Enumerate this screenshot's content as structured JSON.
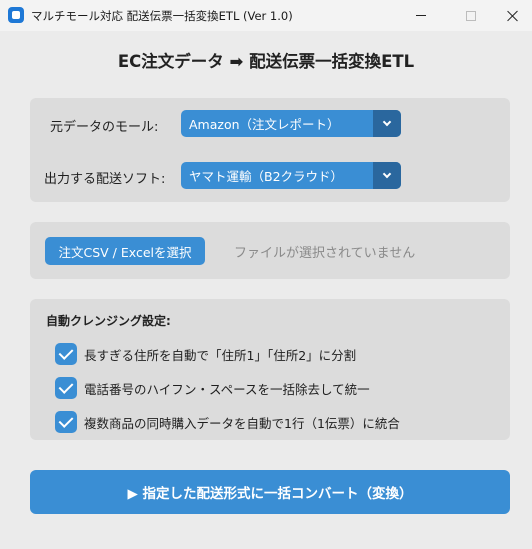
{
  "window": {
    "title": "マルチモール対応 配送伝票一括変換ETL (Ver 1.0)",
    "icon": "app-icon"
  },
  "heading": "EC注文データ ➡ 配送伝票一括変換ETL",
  "source": {
    "label": "元データのモール:",
    "selected": "Amazon（注文レポート）"
  },
  "output": {
    "label": "出力する配送ソフト:",
    "selected": "ヤマト運輸（B2クラウド）"
  },
  "file": {
    "button_label": "注文CSV / Excelを選択",
    "status": "ファイルが選択されていません"
  },
  "options": {
    "title": "自動クレンジング設定:",
    "items": [
      {
        "label": "長すぎる住所を自動で「住所1」「住所2」に分割",
        "checked": true
      },
      {
        "label": "電話番号のハイフン・スペースを一括除去して統一",
        "checked": true
      },
      {
        "label": "複数商品の同時購入データを自動で1行（1伝票）に統合",
        "checked": true
      }
    ]
  },
  "convert_button": "▶ 指定した配送形式に一括コンバート（変換）",
  "colors": {
    "accent": "#3a8ed4",
    "accent_dark": "#2a679e",
    "panel": "#dcdcdc",
    "background": "#ebebeb"
  }
}
